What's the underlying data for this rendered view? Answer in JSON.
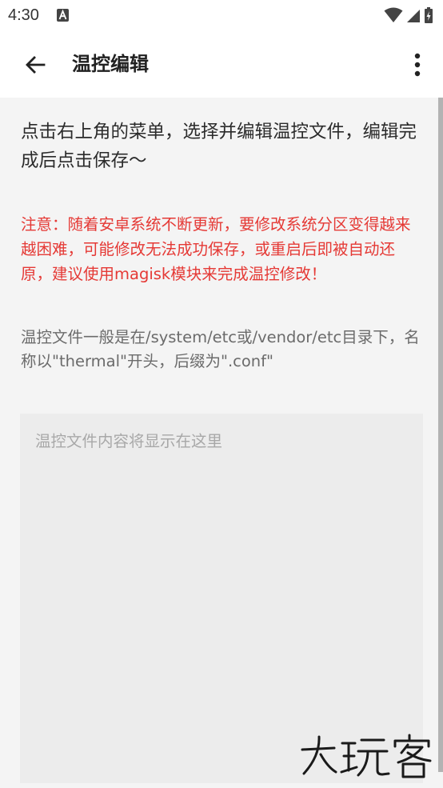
{
  "status_bar": {
    "time": "4:30",
    "icons": [
      "a-notification-icon",
      "wifi-icon",
      "signal-icon",
      "battery-icon"
    ]
  },
  "app_bar": {
    "title": "温控编辑",
    "back_icon": "arrow-left-icon",
    "more_icon": "more-vert-icon"
  },
  "content": {
    "instructions": "点击右上角的菜单，选择并编辑温控文件，编辑完成后点击保存～",
    "warning": "注意：随着安卓系统不断更新，要修改系统分区变得越来越困难，可能修改无法成功保存，或重启后即被自动还原，建议使用magisk模块来完成温控修改！",
    "hint": "温控文件一般是在/system/etc或/vendor/etc目录下，名称以\"thermal\"开头，后缀为\".conf\"",
    "editor_placeholder": "温控文件内容将显示在这里"
  },
  "watermark": {
    "text": "大玩客"
  },
  "colors": {
    "warning": "#e53935",
    "content_background": "#f4f4f4",
    "editor_background": "#ececec"
  }
}
